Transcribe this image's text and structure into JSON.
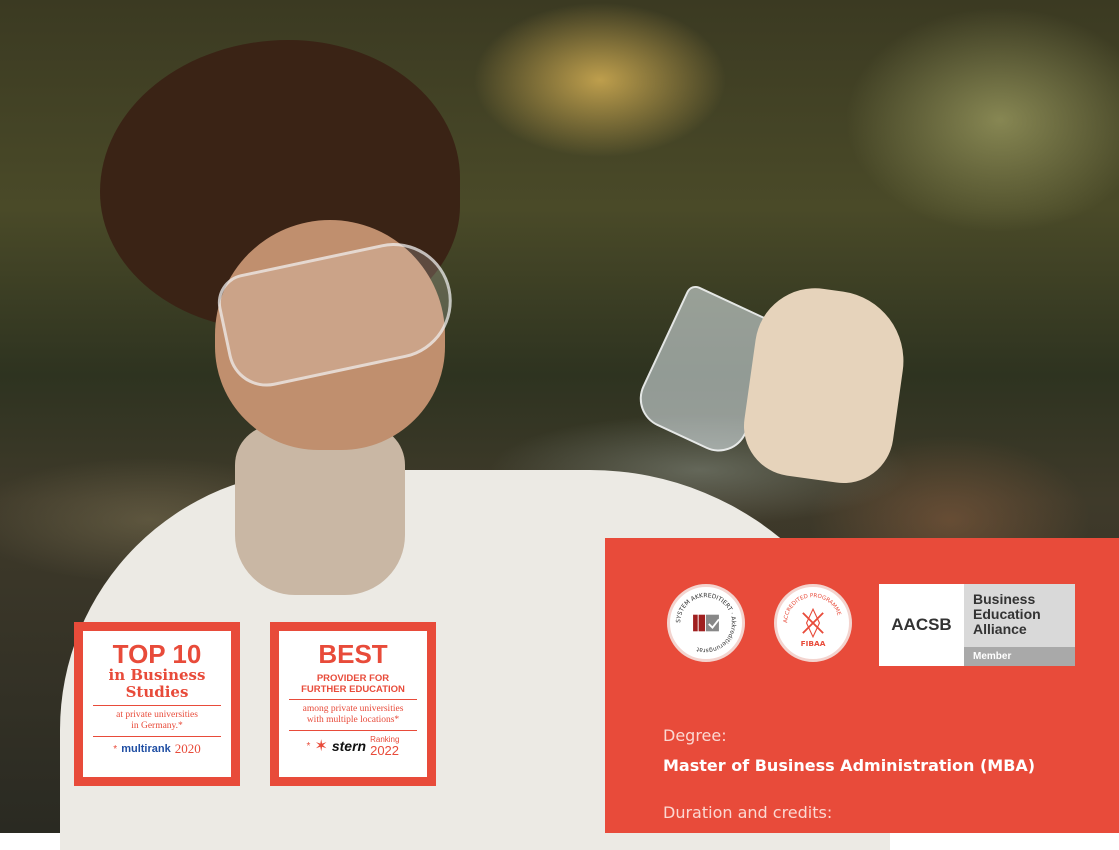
{
  "badges": {
    "top10": {
      "title": "TOP 10",
      "subtitle_line1": "in Business",
      "subtitle_line2": "Studies",
      "note_line1": "at private universities",
      "note_line2": "in Germany.*",
      "source": "multirank",
      "year": "2020"
    },
    "best": {
      "title": "BEST",
      "caps_line1": "PROVIDER FOR",
      "caps_line2": "FURTHER EDUCATION",
      "note_line1": "among private universities",
      "note_line2": "with multiple locations*",
      "source": "stern",
      "ranking_label": "Ranking",
      "year": "2022"
    }
  },
  "accreditations": {
    "seal1_text": "SYSTEM AKKREDITIERT · Akkreditierungsrat",
    "seal2_top": "ACCREDITED PROGRAMME",
    "seal2_bottom": "FIBAA",
    "aacsb_mark": "AACSB",
    "aacsb_line1": "Business",
    "aacsb_line2": "Education",
    "aacsb_line3": "Alliance",
    "aacsb_member": "Member"
  },
  "program": {
    "degree_label": "Degree:",
    "degree_value": "Master of Business Administration (MBA)",
    "duration_label": "Duration and credits:"
  },
  "colors": {
    "accent": "#e84b3a",
    "white": "#ffffff"
  }
}
